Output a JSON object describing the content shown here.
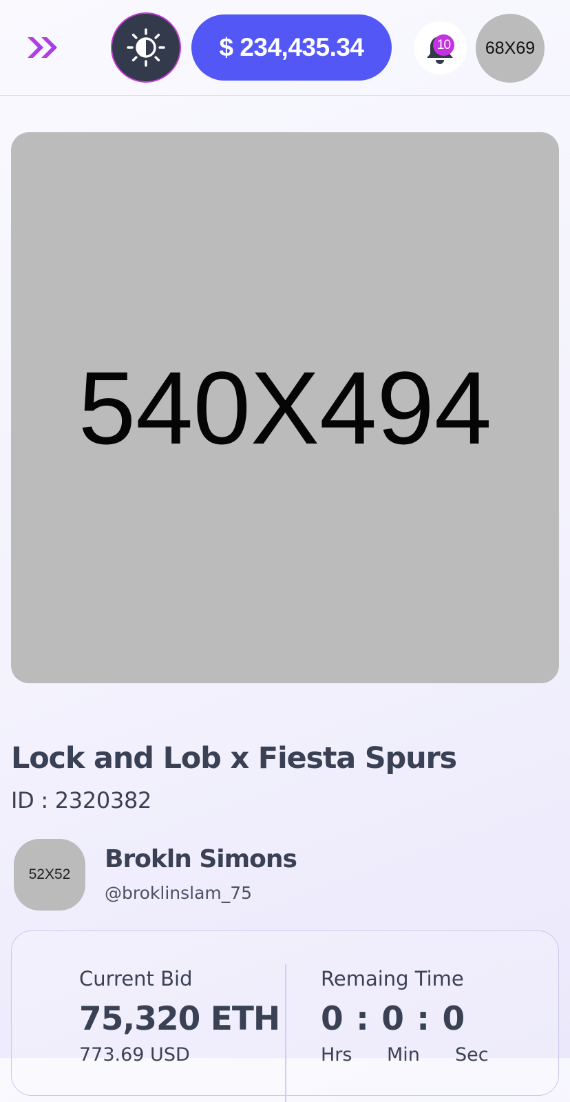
{
  "header": {
    "menu_icon": "double-chevron-right-icon",
    "theme_icon": "sun-half-icon",
    "balance": "$ 234,435.34",
    "notification_icon": "bell-icon",
    "notification_count": "10",
    "avatar_placeholder": "68X69"
  },
  "colors": {
    "accent_blue": "#5257f6",
    "accent_purple": "#c334e0",
    "dark_button": "#323a4b",
    "text_dark": "#3a4154",
    "placeholder_gray": "#bbbbbb"
  },
  "nft": {
    "image_placeholder": "540X494",
    "title": "Lock and Lob x Fiesta Spurs",
    "id_text": "ID : 2320382"
  },
  "creator": {
    "avatar_placeholder": "52X52",
    "name": "Brokln Simons",
    "handle": "@broklinslam_75"
  },
  "bid": {
    "label": "Current Bid",
    "value": "75,320 ETH",
    "usd": "773.69 USD"
  },
  "timer": {
    "label": "Remaing Time",
    "value": "0 : 0 : 0",
    "units": [
      "Hrs",
      "Min",
      "Sec"
    ]
  }
}
